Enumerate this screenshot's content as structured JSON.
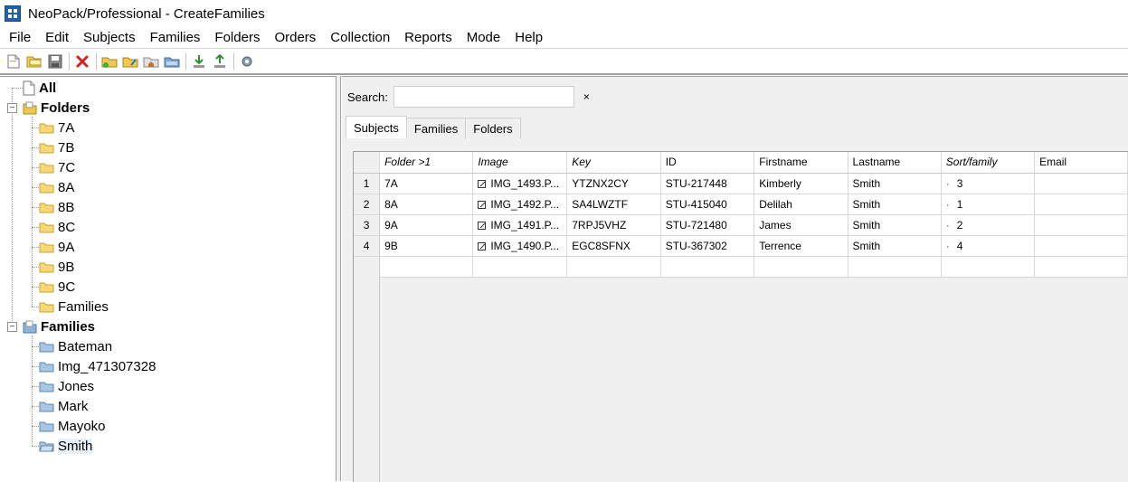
{
  "window": {
    "title": "NeoPack/Professional - CreateFamilies"
  },
  "menu": [
    "File",
    "Edit",
    "Subjects",
    "Families",
    "Folders",
    "Orders",
    "Collection",
    "Reports",
    "Mode",
    "Help"
  ],
  "toolbar": {
    "icons": [
      "new-file-icon",
      "open-folder-icon",
      "save-icon",
      "delete-icon",
      "folder-add-icon",
      "folder-edit-icon",
      "folder-home-icon",
      "folder-move-icon",
      "import-icon",
      "export-icon",
      "settings-icon"
    ]
  },
  "tree": {
    "all": "All",
    "folders_label": "Folders",
    "folders": [
      "7A",
      "7B",
      "7C",
      "8A",
      "8B",
      "8C",
      "9A",
      "9B",
      "9C",
      "Families"
    ],
    "families_label": "Families",
    "families": [
      "Bateman",
      "Img_471307328",
      "Jones",
      "Mark",
      "Mayoko",
      "Smith"
    ],
    "selected": "Smith"
  },
  "search": {
    "label": "Search:",
    "value": "",
    "clear": "×"
  },
  "tabs": [
    "Subjects",
    "Families",
    "Folders"
  ],
  "active_tab": "Subjects",
  "grid": {
    "columns": [
      "Folder >1",
      "Image",
      "Key",
      "ID",
      "Firstname",
      "Lastname",
      "Sort/family",
      "Email"
    ],
    "rows": [
      {
        "num": "1",
        "folder": "7A",
        "image": "IMG_1493.P...",
        "key": "YTZNX2CY",
        "id": "STU-217448",
        "firstname": "Kimberly",
        "lastname": "Smith",
        "sort": "3",
        "email": ""
      },
      {
        "num": "2",
        "folder": "8A",
        "image": "IMG_1492.P...",
        "key": "SA4LWZTF",
        "id": "STU-415040",
        "firstname": "Delilah",
        "lastname": "Smith",
        "sort": "1",
        "email": ""
      },
      {
        "num": "3",
        "folder": "9A",
        "image": "IMG_1491.P...",
        "key": "7RPJ5VHZ",
        "id": "STU-721480",
        "firstname": "James",
        "lastname": "Smith",
        "sort": "2",
        "email": ""
      },
      {
        "num": "4",
        "folder": "9B",
        "image": "IMG_1490.P...",
        "key": "EGC8SFNX",
        "id": "STU-367302",
        "firstname": "Terrence",
        "lastname": "Smith",
        "sort": "4",
        "email": ""
      }
    ]
  }
}
